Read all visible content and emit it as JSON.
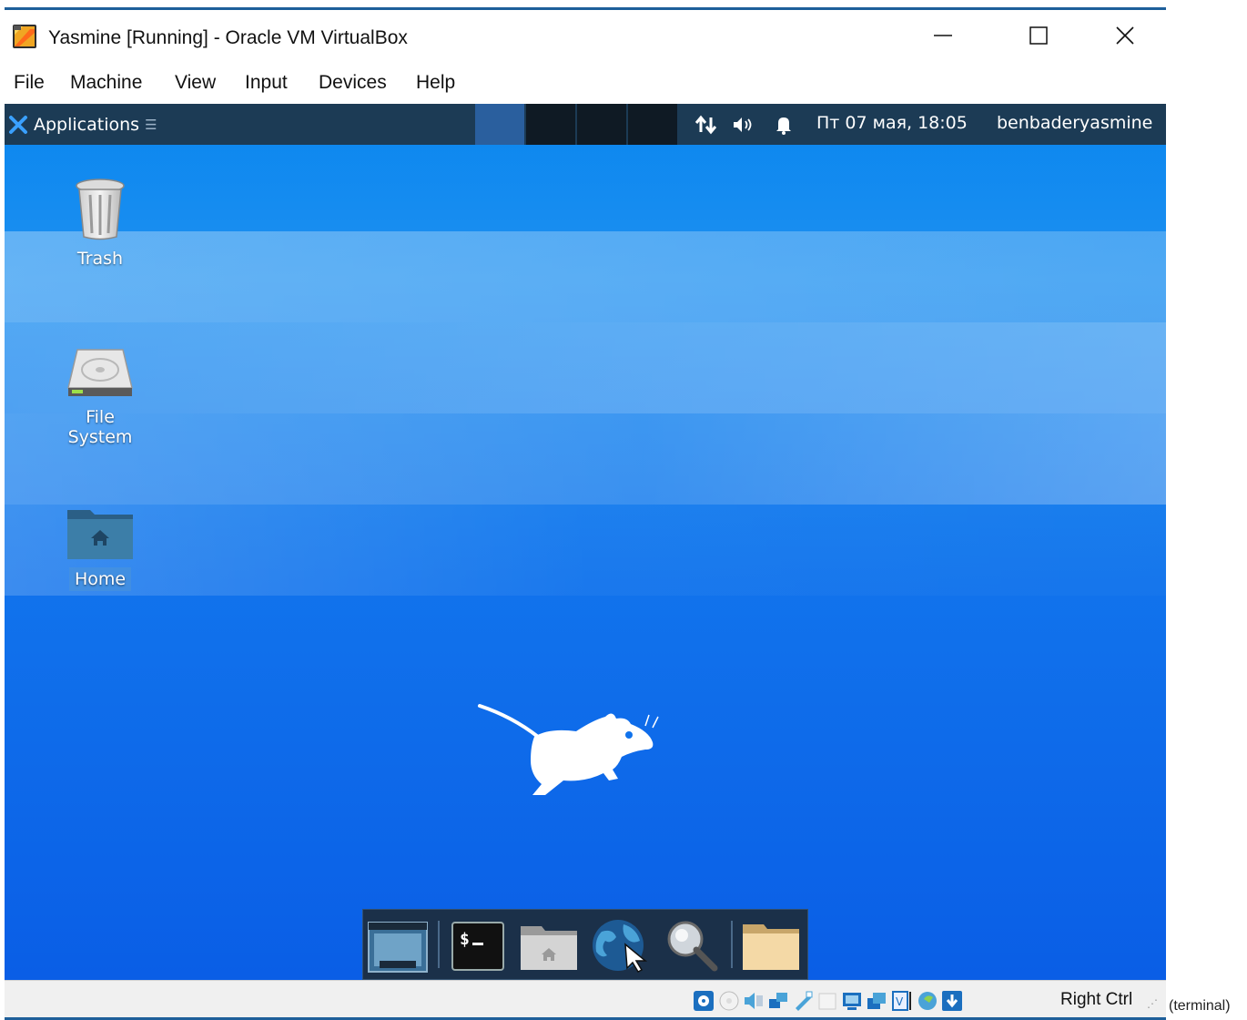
{
  "window": {
    "title": "Yasmine [Running] - Oracle VM VirtualBox"
  },
  "menu": [
    "File",
    "Machine",
    "View",
    "Input",
    "Devices",
    "Help"
  ],
  "panel": {
    "applications_label": "Applications",
    "datetime": "Пт 07 мая, 18:05",
    "user": "benbaderyasmine",
    "icons": [
      "network-icon",
      "volume-icon",
      "notification-bell-icon"
    ]
  },
  "desktop_icons": [
    {
      "name": "Trash",
      "icon": "trash-icon"
    },
    {
      "name": "File System",
      "icon": "hard-drive-icon"
    },
    {
      "name": "Home",
      "icon": "home-folder-icon"
    }
  ],
  "dock": [
    "show-desktop-icon",
    "terminal-icon",
    "file-manager-icon",
    "web-browser-icon",
    "app-finder-icon",
    "folder-icon"
  ],
  "status_bar": {
    "host_key": "Right Ctrl"
  },
  "outside_label": "(terminal)",
  "colors": {
    "panel": "#1c3b55",
    "desktop": "#1173ec",
    "dock": "#1b3049",
    "accent": "#1e5f9a"
  }
}
